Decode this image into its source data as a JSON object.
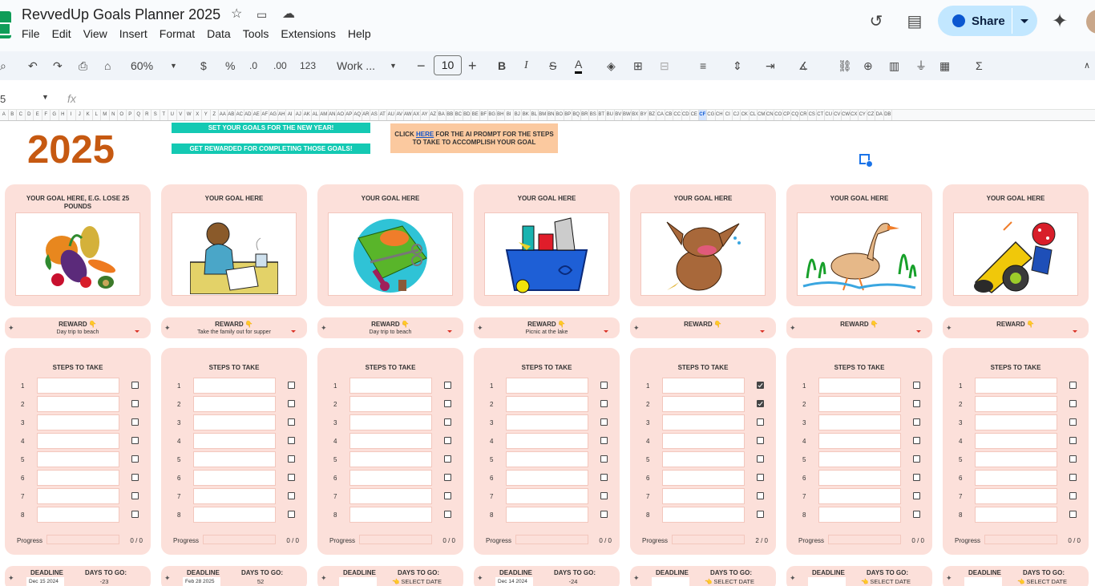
{
  "doc": {
    "title": "RevvedUp Goals Planner 2025"
  },
  "menu": [
    "File",
    "Edit",
    "View",
    "Insert",
    "Format",
    "Data",
    "Tools",
    "Extensions",
    "Help"
  ],
  "share": {
    "label": "Share",
    "accent": "#c2e7ff"
  },
  "toolbar": {
    "zoom": "60%",
    "currency": "$",
    "percent": "%",
    "dec_less": ".0",
    "dec_more": ".00",
    "format_num": "123",
    "font": "Work ...",
    "font_size": "10",
    "bold": "B",
    "italic": "I",
    "strike": "S",
    "text_color": "A",
    "sum": "Σ"
  },
  "formula": {
    "namebox": "5",
    "fx": "fx"
  },
  "columns": {
    "labels": [
      "A",
      "B",
      "C",
      "D",
      "E",
      "F",
      "G",
      "H",
      "I",
      "J",
      "K",
      "L",
      "M",
      "N",
      "O",
      "P",
      "Q",
      "R",
      "S",
      "T",
      "U",
      "V",
      "W",
      "X",
      "Y",
      "Z",
      "AA",
      "AB",
      "AC",
      "AD",
      "AE",
      "AF",
      "AG",
      "AH",
      "AI",
      "AJ",
      "AK",
      "AL",
      "AM",
      "AN",
      "AO",
      "AP",
      "AQ",
      "AR",
      "AS",
      "AT",
      "AU",
      "AV",
      "AW",
      "AX",
      "AY",
      "AZ",
      "BA",
      "BB",
      "BC",
      "BD",
      "BE",
      "BF",
      "BG",
      "BH",
      "BI",
      "BJ",
      "BK",
      "BL",
      "BM",
      "BN",
      "BO",
      "BP",
      "BQ",
      "BR",
      "BS",
      "BT",
      "BU",
      "BV",
      "BW",
      "BX",
      "BY",
      "BZ",
      "CA",
      "CB",
      "CC",
      "CD",
      "CE",
      "CF",
      "CG",
      "CH",
      "CI",
      "CJ",
      "CK",
      "CL",
      "CM",
      "CN",
      "CO",
      "CP",
      "CQ",
      "CR",
      "CS",
      "CT",
      "CU",
      "CV",
      "CW",
      "CX",
      "CY",
      "CZ",
      "DA",
      "DB"
    ],
    "selected": "CF"
  },
  "sheet": {
    "year": "2025",
    "banner1": "SET YOUR GOALS FOR THE NEW YEAR!",
    "banner2": "GET REWARDED FOR COMPLETING THOSE GOALS!",
    "ai_prefix": "CLICK ",
    "ai_link": "HERE",
    "ai_suffix": " FOR THE AI PROMPT FOR THE STEPS TO TAKE TO ACCOMPLISH YOUR GOAL",
    "steps_title": "STEPS TO TAKE",
    "progress_label": "Progress",
    "deadline_label": "DEADLINE",
    "days_label": "DAYS TO GO:",
    "reward_title": "REWARD 👇",
    "step_numbers": [
      "1",
      "2",
      "3",
      "4",
      "5",
      "6",
      "7",
      "8"
    ]
  },
  "goals": [
    {
      "title": "YOUR GOAL HERE, E.G. LOSE 25 POUNDS",
      "image": "vegetables-image",
      "reward": "Day trip to beach",
      "checks": [
        false,
        false,
        false,
        false,
        false,
        false,
        false,
        false
      ],
      "progress": "0 / 0",
      "deadline": "Dec 15 2024",
      "days": "-23"
    },
    {
      "title": "YOUR GOAL HERE",
      "image": "writer-image",
      "reward": "Take the family out for supper",
      "checks": [
        false,
        false,
        false,
        false,
        false,
        false,
        false,
        false
      ],
      "progress": "0 / 0",
      "deadline": "Feb 28 2025",
      "days": "52"
    },
    {
      "title": "YOUR GOAL HERE",
      "image": "sewing-image",
      "reward": "Day trip to beach",
      "checks": [
        false,
        false,
        false,
        false,
        false,
        false,
        false,
        false
      ],
      "progress": "0 / 0",
      "deadline": "",
      "days": "👈 SELECT DATE"
    },
    {
      "title": "YOUR GOAL HERE",
      "image": "recycling-image",
      "reward": "Picnic at the lake",
      "checks": [
        false,
        false,
        false,
        false,
        false,
        false,
        false,
        false
      ],
      "progress": "0 / 0",
      "deadline": "Dec 14 2024",
      "days": "-24"
    },
    {
      "title": "YOUR GOAL HERE",
      "image": "laughing-dog-image",
      "reward": "",
      "checks": [
        true,
        true,
        false,
        false,
        false,
        false,
        false,
        false
      ],
      "progress": "2 / 0",
      "deadline": "",
      "days": "👈 SELECT DATE"
    },
    {
      "title": "YOUR GOAL HERE",
      "image": "goose-image",
      "reward": "",
      "checks": [
        false,
        false,
        false,
        false,
        false,
        false,
        false,
        false
      ],
      "progress": "0 / 0",
      "deadline": "",
      "days": "👈 SELECT DATE"
    },
    {
      "title": "YOUR GOAL HERE",
      "image": "cannon-image",
      "reward": "",
      "checks": [
        false,
        false,
        false,
        false,
        false,
        false,
        false,
        false
      ],
      "progress": "0 / 0",
      "deadline": "",
      "days": "👈 SELECT DATE"
    }
  ]
}
